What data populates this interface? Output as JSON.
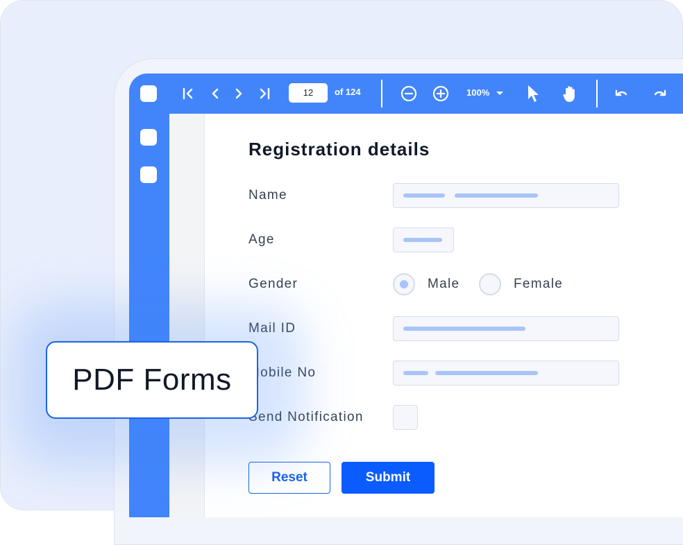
{
  "toolbar": {
    "page_number": "12",
    "page_total": "of 124",
    "zoom": "100%",
    "icons": [
      "first-page-icon",
      "previous-page-icon",
      "next-page-icon",
      "last-page-icon",
      "zoom-out-icon",
      "zoom-in-icon",
      "chevron-down-icon",
      "select-pointer-icon",
      "pan-hand-icon",
      "undo-icon",
      "redo-icon"
    ]
  },
  "form": {
    "title": "Registration details",
    "fields": {
      "name": "Name",
      "age": "Age",
      "gender": "Gender",
      "mail": "Mail ID",
      "mobile": "Mobile No",
      "notify": "Send Notification"
    },
    "gender_options": {
      "male": "Male",
      "female": "Female"
    },
    "gender_selected": "Male",
    "reset_label": "Reset",
    "submit_label": "Submit"
  },
  "badge": {
    "label": "PDF Forms"
  },
  "colors": {
    "accent": "#4285fb",
    "primary_button": "#0b5cff",
    "field_background": "#f5f7fd",
    "placeholder_bar": "#a9c4f6",
    "card_background": "#e8eefc"
  }
}
